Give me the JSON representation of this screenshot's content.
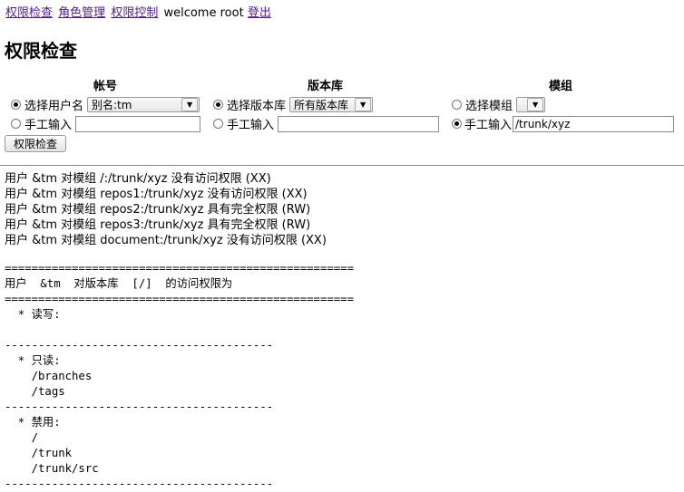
{
  "nav": {
    "links": [
      "权限检查",
      "角色管理",
      "权限控制"
    ],
    "welcome": "welcome root",
    "logout": "登出"
  },
  "title": "权限检查",
  "form": {
    "account": {
      "header": "帐号",
      "select_label": "选择用户名",
      "select_value": "别名:tm",
      "manual_label": "手工输入",
      "manual_value": "",
      "selected": "select"
    },
    "repo": {
      "header": "版本库",
      "select_label": "选择版本库",
      "select_value": "所有版本库",
      "manual_label": "手工输入",
      "manual_value": "",
      "selected": "select"
    },
    "module": {
      "header": "模组",
      "select_label": "选择模组",
      "select_value": "",
      "manual_label": "手工输入",
      "manual_value": "/trunk/xyz",
      "selected": "manual"
    },
    "submit_label": "权限检查"
  },
  "results": [
    "用户 &tm 对模组 /:/trunk/xyz 没有访问权限 (XX)",
    "用户 &tm 对模组 repos1:/trunk/xyz 没有访问权限 (XX)",
    "用户 &tm 对模组 repos2:/trunk/xyz 具有完全权限 (RW)",
    "用户 &tm 对模组 repos3:/trunk/xyz 具有完全权限 (RW)",
    "用户 &tm 对模组 document:/trunk/xyz 没有访问权限 (XX)"
  ],
  "report": "====================================================\n用户  &tm  对版本库  [/]  的访问权限为\n====================================================\n  * 读写:\n\n----------------------------------------\n  * 只读:\n    /branches\n    /tags\n----------------------------------------\n  * 禁用:\n    /\n    /trunk\n    /trunk/src\n----------------------------------------"
}
